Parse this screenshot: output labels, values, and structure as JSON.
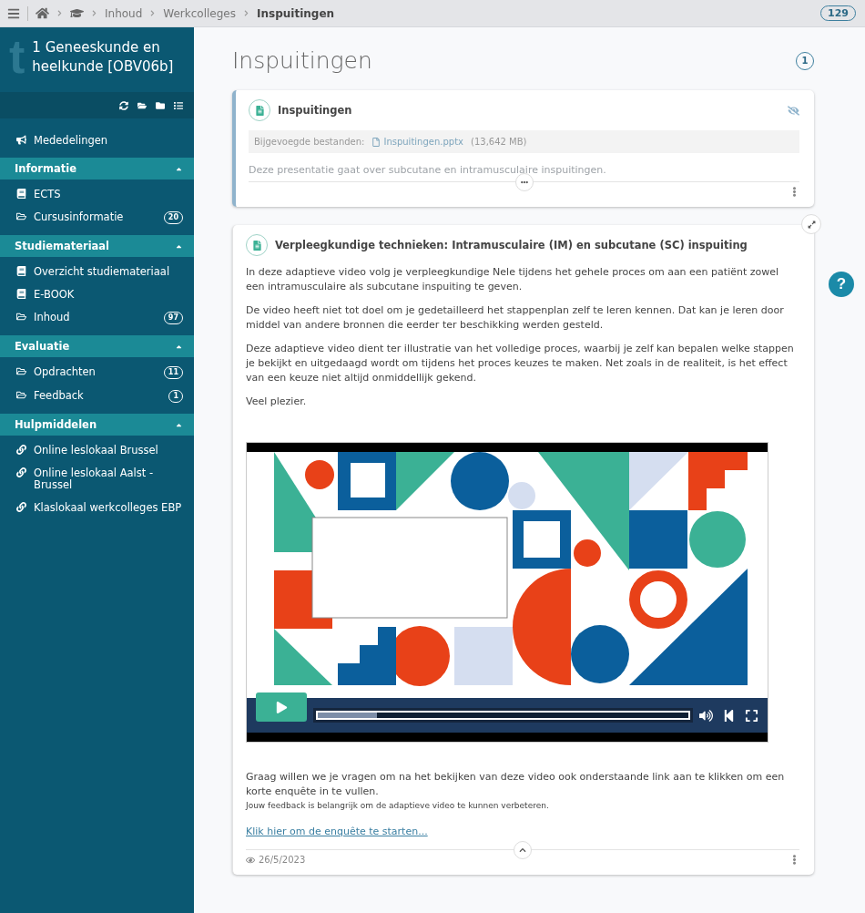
{
  "topbar": {
    "breadcrumbs": [
      {
        "label": "Inhoud",
        "current": false
      },
      {
        "label": "Werkcolleges",
        "current": false
      },
      {
        "label": "Inspuitingen",
        "current": true
      }
    ],
    "notifications": "129"
  },
  "sidebar": {
    "logo_letter": "t",
    "course_title": "1 Geneeskunde en heelkunde [OBV06b]",
    "top_items": [
      {
        "label": "Mededelingen",
        "kind": "announcement"
      }
    ],
    "groups": [
      {
        "title": "Informatie",
        "expanded": true,
        "items": [
          {
            "label": "ECTS",
            "kind": "book"
          },
          {
            "label": "Cursusinformatie",
            "kind": "folder",
            "badge": "20"
          }
        ]
      },
      {
        "title": "Studiemateriaal",
        "expanded": true,
        "items": [
          {
            "label": "Overzicht studiemateriaal",
            "kind": "book"
          },
          {
            "label": "E-BOOK",
            "kind": "book"
          },
          {
            "label": "Inhoud",
            "kind": "folder",
            "badge": "97"
          }
        ]
      },
      {
        "title": "Evaluatie",
        "expanded": true,
        "items": [
          {
            "label": "Opdrachten",
            "kind": "folder",
            "badge": "11"
          },
          {
            "label": "Feedback",
            "kind": "folder",
            "badge": "1"
          }
        ]
      },
      {
        "title": "Hulpmiddelen",
        "expanded": true,
        "items": [
          {
            "label": "Online leslokaal Brussel",
            "kind": "link"
          },
          {
            "label": "Online leslokaal Aalst - Brussel",
            "kind": "link"
          },
          {
            "label": "Klaslokaal werkcolleges EBP",
            "kind": "link"
          }
        ]
      }
    ]
  },
  "page": {
    "title": "Inspuitingen",
    "count": "1"
  },
  "cards": [
    {
      "title": "Inspuitingen",
      "hidden": true,
      "collapsed": true,
      "attachments_label": "Bijgevoegde bestanden:",
      "file_name": "Inspuitingen.pptx",
      "file_size": "(13,642 MB)",
      "description": "Deze presentatie gaat over subcutane en intramusculaire inspuitingen."
    },
    {
      "title": "Verpleegkundige technieken: Intramusculaire (IM) en subcutane (SC) inspuiting",
      "hidden": false,
      "collapsed": false,
      "paragraphs": [
        "In deze adaptieve video volg je verpleegkundige Nele tijdens het gehele proces om aan een patiënt zowel een intramusculaire als subcutane inspuiting te geven.",
        "De video heeft niet tot doel om je gedetailleerd het stappenplan zelf te leren kennen. Dat kan je leren door middel van andere bronnen die eerder ter beschikking werden gesteld.",
        "Deze adaptieve video dient ter illustratie van het volledige proces, waarbij je zelf kan bepalen welke stappen je bekijkt en uitgedaagd wordt om tijdens het proces keuzes te maken. Net zoals in de realiteit, is het effect van een keuze niet altijd onmiddellijk gekend.",
        "Veel plezier."
      ],
      "video": {
        "level": 0.16
      },
      "outro": "Graag willen we je vragen om na het bekijken van deze video ook onderstaande link aan te klikken om een korte enquête in te vullen.",
      "note": "Jouw feedback is belangrijk om de adaptieve video te kunnen verbeteren.",
      "link": "Klik hier om de enquête te starten...",
      "date": "26/5/2023"
    }
  ],
  "help": "?"
}
